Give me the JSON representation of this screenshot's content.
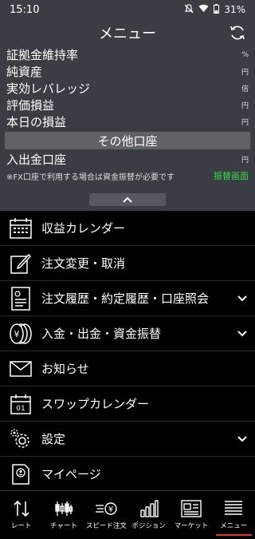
{
  "status": {
    "time": "15:10",
    "battery": "31%"
  },
  "header": {
    "title": "メニュー"
  },
  "account": {
    "rows": [
      {
        "label": "証拠金維持率",
        "unit": "%"
      },
      {
        "label": "純資産",
        "unit": "円"
      },
      {
        "label": "実効レバレッジ",
        "unit": "倍"
      },
      {
        "label": "評価損益",
        "unit": "円"
      },
      {
        "label": "本日の損益",
        "unit": "円"
      }
    ],
    "other_section": "その他口座",
    "deposit_row": {
      "label": "入出金口座",
      "unit": "円"
    },
    "note": "※FX口座で利用する場合は資金振替が必要です",
    "transfer_link": "振替画面"
  },
  "menu": {
    "items": [
      {
        "label": "収益カレンダー",
        "icon": "calendar-icon",
        "expandable": false
      },
      {
        "label": "注文変更・取消",
        "icon": "edit-icon",
        "expandable": false
      },
      {
        "label": "注文履歴・約定履歴・口座照会",
        "icon": "document-icon",
        "expandable": true
      },
      {
        "label": "入金・出金・資金振替",
        "icon": "coins-icon",
        "expandable": true
      },
      {
        "label": "お知らせ",
        "icon": "mail-icon",
        "expandable": false
      },
      {
        "label": "スワップカレンダー",
        "icon": "swap-calendar-icon",
        "expandable": false
      },
      {
        "label": "設定",
        "icon": "gear-icon",
        "expandable": true
      },
      {
        "label": "マイページ",
        "icon": "mypage-icon",
        "expandable": false
      }
    ]
  },
  "tabs": [
    {
      "label": "レート",
      "icon": "rate-icon",
      "active": false
    },
    {
      "label": "チャート",
      "icon": "chart-icon",
      "active": false
    },
    {
      "label": "スピード注文",
      "icon": "speed-order-icon",
      "active": false
    },
    {
      "label": "ポジション",
      "icon": "position-icon",
      "active": false
    },
    {
      "label": "マーケット",
      "icon": "market-icon",
      "active": false
    },
    {
      "label": "メニュー",
      "icon": "menu-icon",
      "active": true
    }
  ],
  "colors": {
    "panel": "#3a3d44",
    "accent_green": "#3cd64a",
    "active_tab": "#e23232"
  }
}
